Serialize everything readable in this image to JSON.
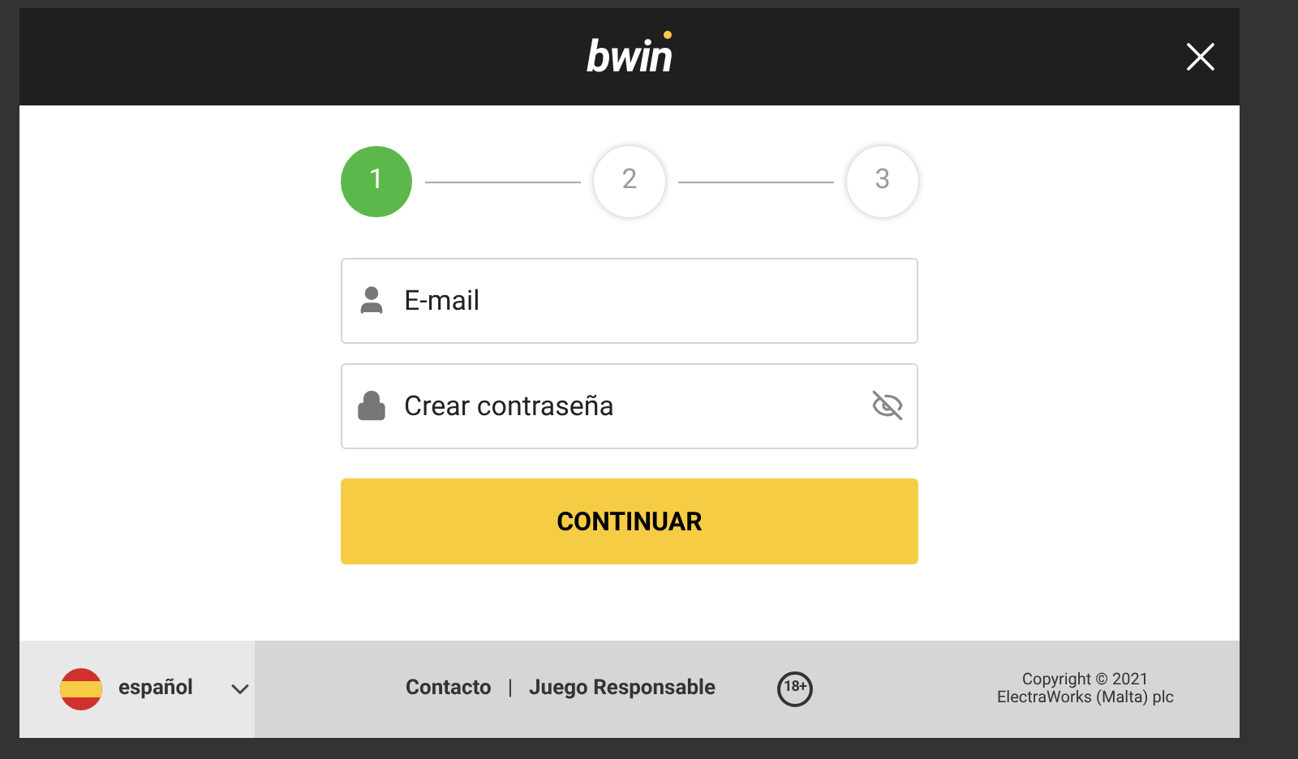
{
  "header": {
    "logo": "bwin"
  },
  "steps": [
    {
      "label": "1",
      "selected": true
    },
    {
      "label": "2",
      "selected": false
    },
    {
      "label": "3",
      "selected": false
    }
  ],
  "fields": [
    {
      "kind": "email",
      "placeholder": "E-mail"
    },
    {
      "kind": "password",
      "placeholder": "Crear contraseña"
    }
  ],
  "continue_button": "CONTINUAR",
  "footer": {
    "language": "español",
    "links": [
      "Contacto",
      "Juego Responsable"
    ],
    "separator": "|",
    "age_badge": "18+",
    "copyright": [
      "Copyright © 2021",
      "ElectraWorks (Malta) plc"
    ]
  }
}
